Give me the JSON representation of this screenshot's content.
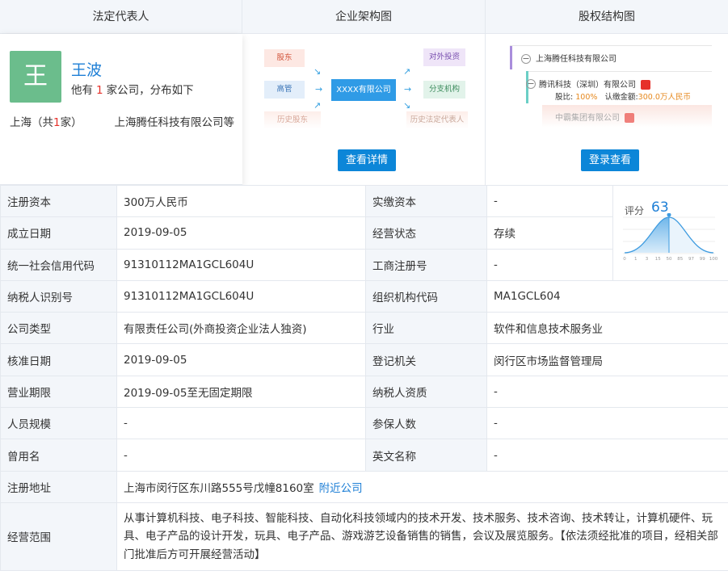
{
  "tabs": {
    "legal_rep": "法定代表人",
    "org_chart": "企业架构图",
    "equity": "股权结构图"
  },
  "legal": {
    "avatar_char": "王",
    "name": "王波",
    "sub_prefix": "他有",
    "company_count": "1",
    "sub_suffix": "家公司，分布如下",
    "region_prefix": "上海（共",
    "region_count": "1",
    "region_suffix": "家）",
    "region_companies": "上海腾任科技有限公司等"
  },
  "org": {
    "shareholder": "股东",
    "management": "高管",
    "history_shareholder": "历史股东",
    "company": "XXXX有限公司",
    "investment": "对外投资",
    "branch": "分支机构",
    "history_legal": "历史法定代表人",
    "detail_button": "查看详情"
  },
  "equity": {
    "root": "上海腾任科技有限公司",
    "child1": "腾讯科技（深圳）有限公司",
    "child1_ratio_label": "股比:",
    "child1_ratio": "100%",
    "child1_capital_label": "认缴金额:",
    "child1_capital": "300.0万人民币",
    "child2": "中霸集团有限公司",
    "login_button": "登录查看"
  },
  "score": {
    "label": "评分",
    "value": "63",
    "ticks": [
      "0",
      "1",
      "3",
      "15",
      "50",
      "85",
      "97",
      "99",
      "100"
    ],
    "marker_percentile": 50
  },
  "info": {
    "reg_capital_k": "注册资本",
    "reg_capital_v": "300万人民币",
    "paid_capital_k": "实缴资本",
    "paid_capital_v": "-",
    "est_date_k": "成立日期",
    "est_date_v": "2019-09-05",
    "status_k": "经营状态",
    "status_v": "存续",
    "credit_code_k": "统一社会信用代码",
    "credit_code_v": "91310112MA1GCL604U",
    "biz_reg_k": "工商注册号",
    "biz_reg_v": "-",
    "taxpayer_id_k": "纳税人识别号",
    "taxpayer_id_v": "91310112MA1GCL604U",
    "org_code_k": "组织机构代码",
    "org_code_v": "MA1GCL604",
    "type_k": "公司类型",
    "type_v": "有限责任公司(外商投资企业法人独资)",
    "industry_k": "行业",
    "industry_v": "软件和信息技术服务业",
    "approve_date_k": "核准日期",
    "approve_date_v": "2019-09-05",
    "authority_k": "登记机关",
    "authority_v": "闵行区市场监督管理局",
    "term_k": "营业期限",
    "term_v": "2019-09-05至无固定期限",
    "tax_qual_k": "纳税人资质",
    "tax_qual_v": "-",
    "staff_k": "人员规模",
    "staff_v": "-",
    "insured_k": "参保人数",
    "insured_v": "-",
    "former_name_k": "曾用名",
    "former_name_v": "-",
    "english_name_k": "英文名称",
    "english_name_v": "-",
    "address_k": "注册地址",
    "address_v": "上海市闵行区东川路555号戊幢8160室",
    "nearby_link": "附近公司",
    "scope_k": "经营范围",
    "scope_v": "从事计算机科技、电子科技、智能科技、自动化科技领域内的技术开发、技术服务、技术咨询、技术转让，计算机硬件、玩具、电子产品的设计开发，玩具、电子产品、游戏游艺设备销售的销售，会议及展览服务。【依法须经批准的项目，经相关部门批准后方可开展经营活动】"
  }
}
